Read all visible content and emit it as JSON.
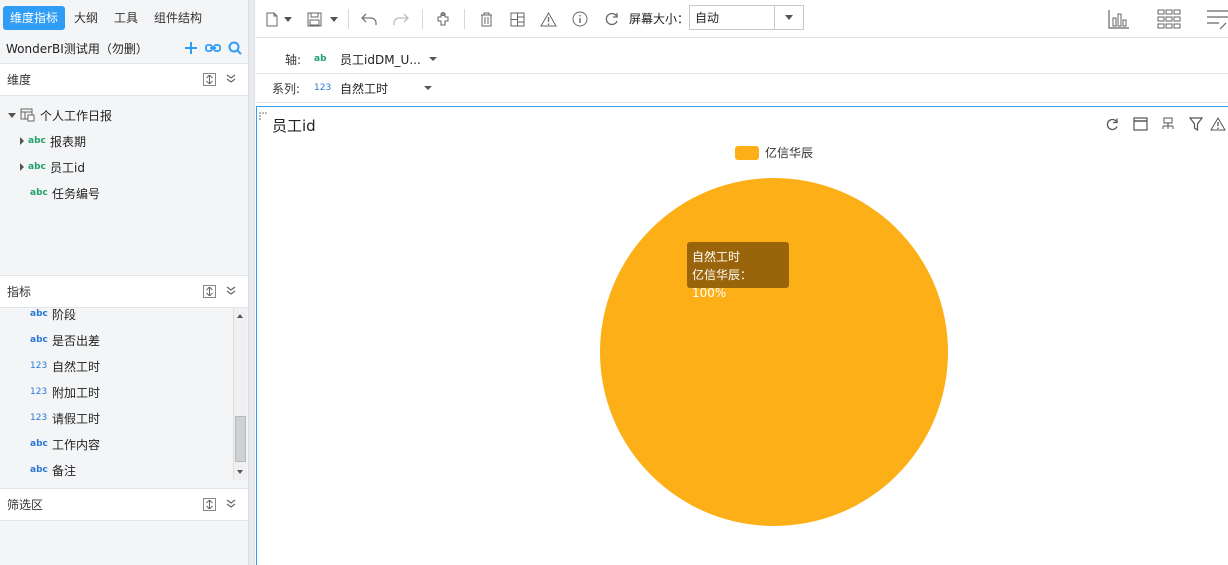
{
  "left_panel": {
    "tabs": [
      {
        "label": "维度指标",
        "active": true
      },
      {
        "label": "大纲",
        "active": false
      },
      {
        "label": "工具",
        "active": false
      },
      {
        "label": "组件结构",
        "active": false
      }
    ],
    "project_name": "WonderBI测试用（勿删）",
    "dimension_section": {
      "title": "维度",
      "table_name": "个人工作日报",
      "fields": [
        {
          "type": "abc",
          "label": "报表期",
          "expandable": true
        },
        {
          "type": "abc",
          "label": "员工id",
          "expandable": true
        },
        {
          "type": "abc",
          "label": "任务编号",
          "expandable": false
        }
      ]
    },
    "metric_section": {
      "title": "指标",
      "fields": [
        {
          "type": "abc",
          "label": "阶段"
        },
        {
          "type": "abc",
          "label": "是否出差"
        },
        {
          "type": "123",
          "label": "自然工时"
        },
        {
          "type": "123",
          "label": "附加工时"
        },
        {
          "type": "123",
          "label": "请假工时"
        },
        {
          "type": "abc",
          "label": "工作内容"
        },
        {
          "type": "abc",
          "label": "备注"
        }
      ]
    },
    "filter_section": {
      "title": "筛选区"
    }
  },
  "toolbar": {
    "screen_size_label": "屏幕大小：",
    "screen_size_value": "自动"
  },
  "config": {
    "axis_label": "轴:",
    "axis_type": "ab",
    "axis_field": "员工idDM_U...",
    "series_label": "系列:",
    "series_type": "123",
    "series_field": "自然工时"
  },
  "widget": {
    "title": "员工id",
    "tooltip": {
      "series": "自然工时",
      "line": "亿信华辰：100%"
    }
  },
  "colors": {
    "accent": "#2f9df6",
    "pie": "#fcaf17",
    "tooltip_bg": "#92600a"
  },
  "chart_data": {
    "type": "pie",
    "title": "员工id",
    "series": [
      {
        "name": "自然工时",
        "values": [
          100
        ]
      }
    ],
    "categories": [
      "亿信华辰"
    ],
    "legend": [
      "亿信华辰"
    ],
    "legend_position": "top-center"
  }
}
